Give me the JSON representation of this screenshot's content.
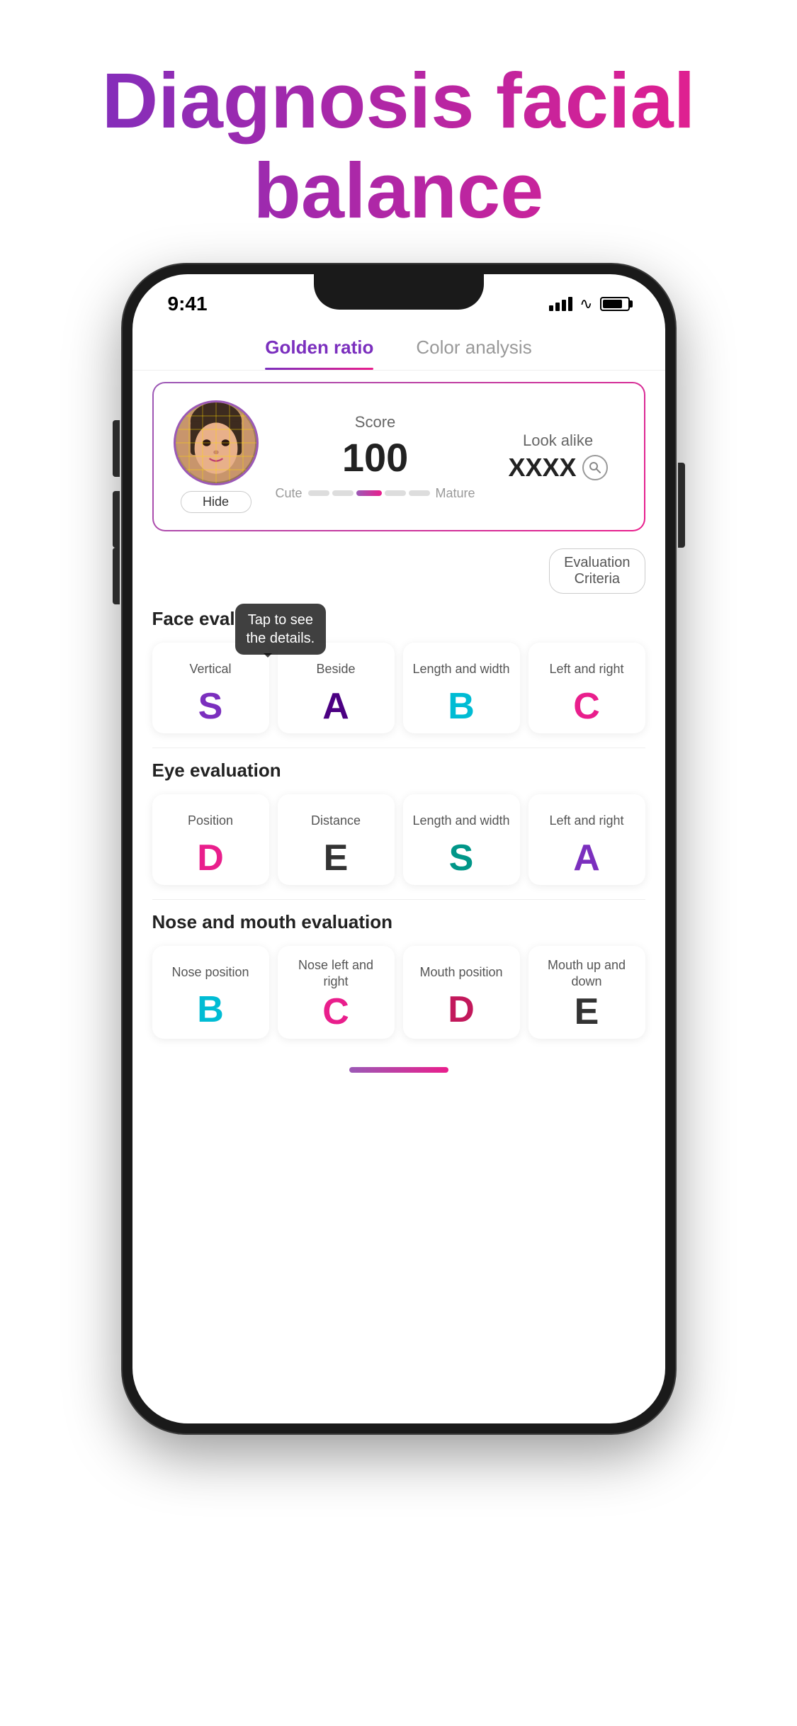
{
  "hero": {
    "title_line1": "Diagnosis facial",
    "title_line2": "balance"
  },
  "phone": {
    "status_bar": {
      "time": "9:41",
      "signal_bars": 4,
      "wifi": true,
      "battery": 80
    },
    "tabs": [
      {
        "id": "golden_ratio",
        "label": "Golden ratio",
        "active": true
      },
      {
        "id": "color_analysis",
        "label": "Color analysis",
        "active": false
      }
    ],
    "score_card": {
      "avatar_label": "Hide",
      "score_label": "Score",
      "score_value": "100",
      "lookalike_label": "Look alike",
      "lookalike_value": "XXXX",
      "cute_label": "Cute",
      "mature_label": "Mature"
    },
    "eval_criteria_btn": "Evaluation\nCriteria",
    "face_eval": {
      "title": "Face eval",
      "tooltip": "Tap to see\nthe details.",
      "items": [
        {
          "label": "Vertical",
          "grade": "S",
          "color": "grade-purple"
        },
        {
          "label": "Beside",
          "grade": "A",
          "color": "grade-dark-purple"
        },
        {
          "label": "Length and width",
          "grade": "B",
          "color": "grade-cyan"
        },
        {
          "label": "Left and right",
          "grade": "C",
          "color": "grade-pink"
        }
      ]
    },
    "eye_eval": {
      "title": "Eye evaluation",
      "items": [
        {
          "label": "Position",
          "grade": "D",
          "color": "grade-pink"
        },
        {
          "label": "Distance",
          "grade": "E",
          "color": "grade-dark"
        },
        {
          "label": "Length and width",
          "grade": "S",
          "color": "grade-teal"
        },
        {
          "label": "Left and right",
          "grade": "A",
          "color": "grade-purple"
        }
      ]
    },
    "nose_mouth_eval": {
      "title": "Nose and mouth evaluation",
      "items": [
        {
          "label": "Nose position",
          "grade": "B",
          "color": "grade-cyan"
        },
        {
          "label": "Nose left and right",
          "grade": "C",
          "color": "grade-pink"
        },
        {
          "label": "Mouth position",
          "grade": "D",
          "color": "grade-magenta"
        },
        {
          "label": "Mouth up and down",
          "grade": "E",
          "color": "grade-dark"
        }
      ]
    }
  }
}
